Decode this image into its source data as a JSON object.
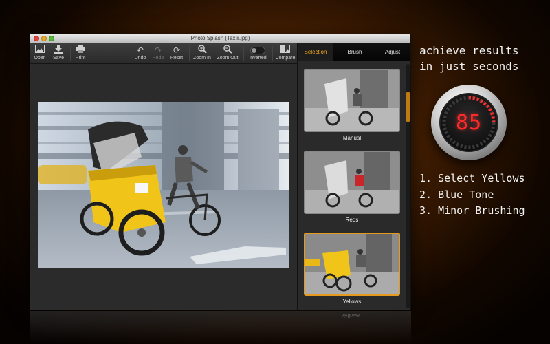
{
  "window": {
    "title": "Photo Splash (Taxiii.jpg)"
  },
  "toolbar": {
    "open": "Open",
    "save": "Save",
    "print": "Print",
    "undo": "Undo",
    "redo": "Redo",
    "reset": "Reset",
    "zoom_in": "Zoom In",
    "zoom_out": "Zoom Out",
    "inverted": "Inverted",
    "compare": "Compare"
  },
  "panel": {
    "tabs": [
      {
        "label": "Selection",
        "active": true
      },
      {
        "label": "Brush",
        "active": false
      },
      {
        "label": "Adjust",
        "active": false
      }
    ],
    "presets": [
      {
        "label": "Manual"
      },
      {
        "label": "Reds"
      },
      {
        "label": "Yellows",
        "selected": true
      }
    ],
    "reflection_label": "Yellows"
  },
  "promo": {
    "headline_1": "achieve results",
    "headline_2": "in just seconds",
    "timer": "85",
    "step_1": "1. Select Yellows",
    "step_2": "2. Blue Tone",
    "step_3": "3. Minor Brushing"
  },
  "colors": {
    "accent": "#f2a81e",
    "selection_border": "#e39a1f",
    "timer_digits": "#ff2a2a",
    "rickshaw_yellow": "#f0c419"
  }
}
